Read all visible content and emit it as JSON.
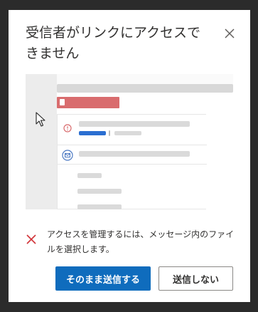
{
  "dialog": {
    "title": "受信者がリンクにアクセスできません",
    "close_icon": "close-icon"
  },
  "notice": {
    "icon": "x-mark-icon",
    "icon_color": "#d13438",
    "message": "アクセスを管理するには、メッセージ内のファイルを選択します。"
  },
  "buttons": {
    "send_anyway": "そのまま送信する",
    "dont_send": "送信しない"
  },
  "colors": {
    "primary": "#0f6cbd",
    "preview_tag": "#d96c6e",
    "preview_highlight": "#2b6fd1"
  }
}
